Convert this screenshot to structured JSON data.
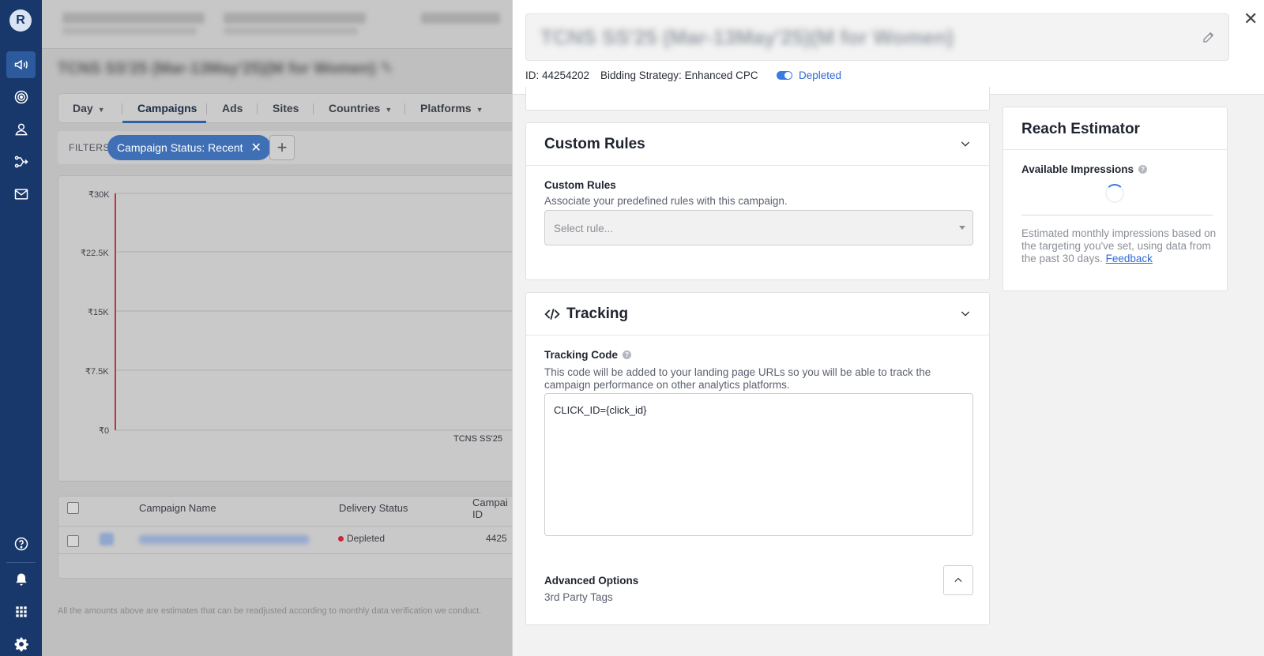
{
  "nav": {
    "logo": "R",
    "icons": [
      "megaphone-icon",
      "target-icon",
      "user-icon",
      "split-icon",
      "mail-icon",
      "help-icon",
      "bell-icon",
      "grid-icon",
      "gear-icon"
    ]
  },
  "background": {
    "tabs": [
      {
        "label": "Day",
        "caret": true
      },
      {
        "label": "Campaigns",
        "caret": false
      },
      {
        "label": "Ads",
        "caret": false
      },
      {
        "label": "Sites",
        "caret": false
      },
      {
        "label": "Countries",
        "caret": true
      },
      {
        "label": "Platforms",
        "caret": true
      }
    ],
    "filters_label": "FILTERS",
    "filter_chip": "Campaign Status: Recent",
    "chart": {
      "y_ticks": [
        "₹30K",
        "₹22.5K",
        "₹15K",
        "₹7.5K",
        "₹0"
      ],
      "x_tick": "TCNS SS'25"
    },
    "table": {
      "headers": [
        "Campaign Name",
        "Delivery Status",
        "Campai ID"
      ],
      "row_status": "Depleted",
      "row_id": "4425"
    },
    "footnote": "All the amounts above are estimates that can be readjusted according to monthly data verification we conduct."
  },
  "drawer": {
    "id_text": "ID: 44254202",
    "bidding_text": "Bidding Strategy: Enhanced CPC",
    "status_text": "Depleted",
    "custom_rules": {
      "title": "Custom Rules",
      "field_label": "Custom Rules",
      "help": "Associate your predefined rules with this campaign.",
      "placeholder": "Select rule..."
    },
    "tracking": {
      "title": "Tracking",
      "field_label": "Tracking Code",
      "help": "This code will be added to your landing page URLs so you will be able to track the campaign performance on other analytics platforms.",
      "code": "CLICK_ID={click_id}",
      "advanced_label": "Advanced Options",
      "advanced_sub": "3rd Party Tags"
    },
    "reach": {
      "title": "Reach Estimator",
      "available_label": "Available Impressions",
      "description": "Estimated monthly impressions based on the targeting you've set, using data from the past 30 days.",
      "feedback_link": "Feedback"
    }
  }
}
